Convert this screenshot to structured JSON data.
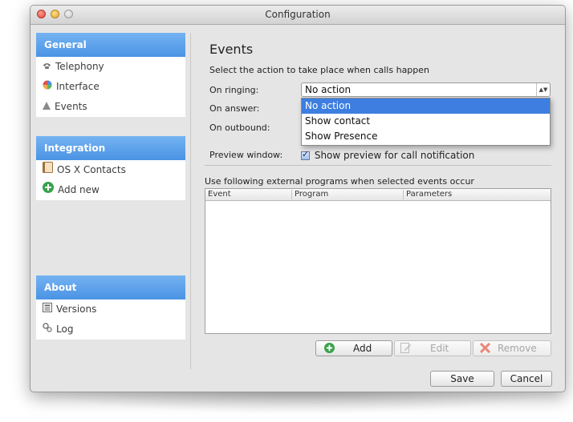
{
  "window": {
    "title": "Configuration"
  },
  "sidebar": {
    "general": {
      "header": "General",
      "items": [
        {
          "label": "Telephony",
          "icon": "phone-icon"
        },
        {
          "label": "Interface",
          "icon": "palette-icon"
        },
        {
          "label": "Events",
          "icon": "events-icon"
        }
      ]
    },
    "integration": {
      "header": "Integration",
      "items": [
        {
          "label": "OS X Contacts",
          "icon": "contacts-book-icon"
        },
        {
          "label": "Add new",
          "icon": "add-circle-icon"
        }
      ]
    },
    "about": {
      "header": "About",
      "items": [
        {
          "label": "Versions",
          "icon": "versions-icon"
        },
        {
          "label": "Log",
          "icon": "log-icon"
        }
      ]
    }
  },
  "events": {
    "title": "Events",
    "subtitle": "Select the action to take place when calls happen",
    "on_ringing_label": "On ringing:",
    "on_answer_label": "On answer:",
    "on_outbound_label": "On outbound:",
    "preview_label": "Preview window:",
    "ringing_value": "No action",
    "dropdown_options": [
      "No action",
      "Show contact",
      "Show Presence"
    ],
    "dropdown_selected": "No action",
    "preview_checkbox_label": "Show preview for call notification",
    "preview_checked": true
  },
  "programs": {
    "label": "Use following external programs when selected events occur",
    "columns": [
      "Event",
      "Program",
      "Parameters"
    ],
    "rows": []
  },
  "buttons": {
    "add": "Add",
    "edit": "Edit",
    "remove": "Remove",
    "save": "Save",
    "cancel": "Cancel"
  },
  "colors": {
    "sidebar_header": "#4a93e4",
    "selection": "#3d7ee0",
    "add_icon": "#3aa14a",
    "remove_icon": "#e04a2a"
  }
}
